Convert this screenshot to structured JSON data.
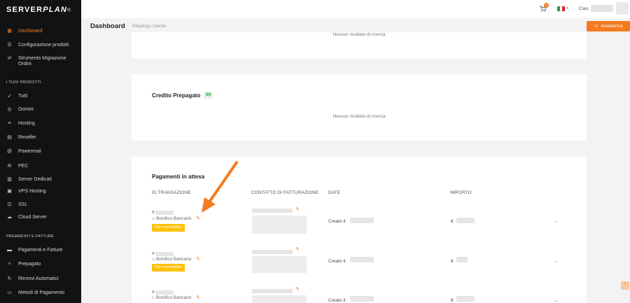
{
  "brand": {
    "logo_server": "SERVER",
    "logo_plan": "PLAN",
    "collapse_icon": "double-chevron-left-icon"
  },
  "sidebar": {
    "items_top": [
      {
        "label": "Dashboard",
        "icon": "grid-icon",
        "active": true
      },
      {
        "label": "Configurazione prodotti",
        "icon": "sliders-icon",
        "active": false
      },
      {
        "label": "Strumento Migrazione Ordini",
        "icon": "migrate-icon",
        "active": false
      }
    ],
    "section_products": "I TUOI PRODOTTI",
    "items_products": [
      {
        "label": "Tutti",
        "icon": "rocket-icon"
      },
      {
        "label": "Domini",
        "icon": "globe-icon"
      },
      {
        "label": "Hosting",
        "icon": "database-icon"
      },
      {
        "label": "Reseller",
        "icon": "server-icon"
      },
      {
        "label": "Powermail",
        "icon": "at-icon"
      },
      {
        "label": "PEC",
        "icon": "envelope-icon"
      },
      {
        "label": "Server Dedicati",
        "icon": "server-rack-icon"
      },
      {
        "label": "VPS Hosting",
        "icon": "vps-icon"
      },
      {
        "label": "SSL",
        "icon": "lock-icon"
      },
      {
        "label": "Cloud Server",
        "icon": "cloud-icon"
      }
    ],
    "section_payments": "PAGAMENTI E FATTURE",
    "items_payments": [
      {
        "label": "Pagamenti e Fatture",
        "icon": "invoice-icon"
      },
      {
        "label": "Prepagato",
        "icon": "prepaid-icon"
      },
      {
        "label": "Rinnovi Automatici",
        "icon": "refresh-icon"
      },
      {
        "label": "Metodi di Pagamento",
        "icon": "card-icon"
      }
    ]
  },
  "topbar": {
    "cart_count": "0",
    "greeting": "Ciao,",
    "language": "IT"
  },
  "header": {
    "title": "Dashboard",
    "breadcrumb": "Riepilogo Utente",
    "assist_label": "Assistenza"
  },
  "card1": {
    "empty": "Nessun risultato di ricerca"
  },
  "card2": {
    "title": "Credito Prepagato",
    "credit": "€0",
    "empty": "Nessun risultato di ricerca"
  },
  "pending": {
    "title": "Pagamenti in attesa",
    "columns": [
      "ID TRANSAZIONE",
      "CONTATTO DI FATTURAZIONE",
      "DATE",
      "IMPORTO"
    ],
    "rows": [
      {
        "hash": "#",
        "method": "Bonifico Bancario",
        "status": "Non convalidato",
        "created": "Creato il:",
        "amount": "€"
      },
      {
        "hash": "#",
        "method": "Bonifico Bancario",
        "status": "Non convalidato",
        "created": "Creato il:",
        "amount": "€"
      },
      {
        "hash": "#",
        "method": "Bonifico Bancario",
        "status": "",
        "created": "Creato il:",
        "amount": "€"
      }
    ]
  },
  "colors": {
    "accent": "#f47b20",
    "sidebar_bg": "#111214",
    "warning": "#ffc107",
    "success_bg": "#dff4e4"
  }
}
